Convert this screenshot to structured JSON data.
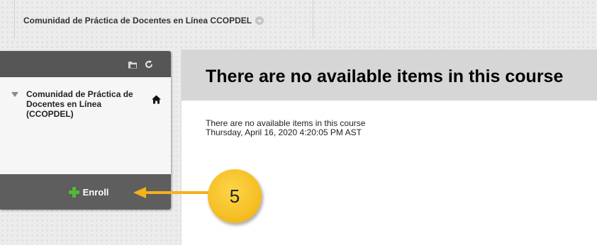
{
  "breadcrumb": {
    "course_title": "Comunidad de Práctica de Docentes en Línea CCOPDEL"
  },
  "course_menu": {
    "toolbar_icons": [
      "folder-icon",
      "refresh-icon"
    ],
    "course_name": "Comunidad de Práctica de Docentes en Línea (CCOPDEL)",
    "enroll_label": "Enroll"
  },
  "content": {
    "title": "There are no available items in this course",
    "message": "There are no available items in this course",
    "timestamp": "Thursday, April 16, 2020 4:20:05 PM AST"
  },
  "annotation": {
    "step_number": "5"
  },
  "colors": {
    "toolbar_bg": "#565656",
    "enroll_bg": "#5e5e5e",
    "plus_green": "#55b83a",
    "callout_yellow": "#f6bf26",
    "content_header_bg": "#d6d6d6"
  }
}
